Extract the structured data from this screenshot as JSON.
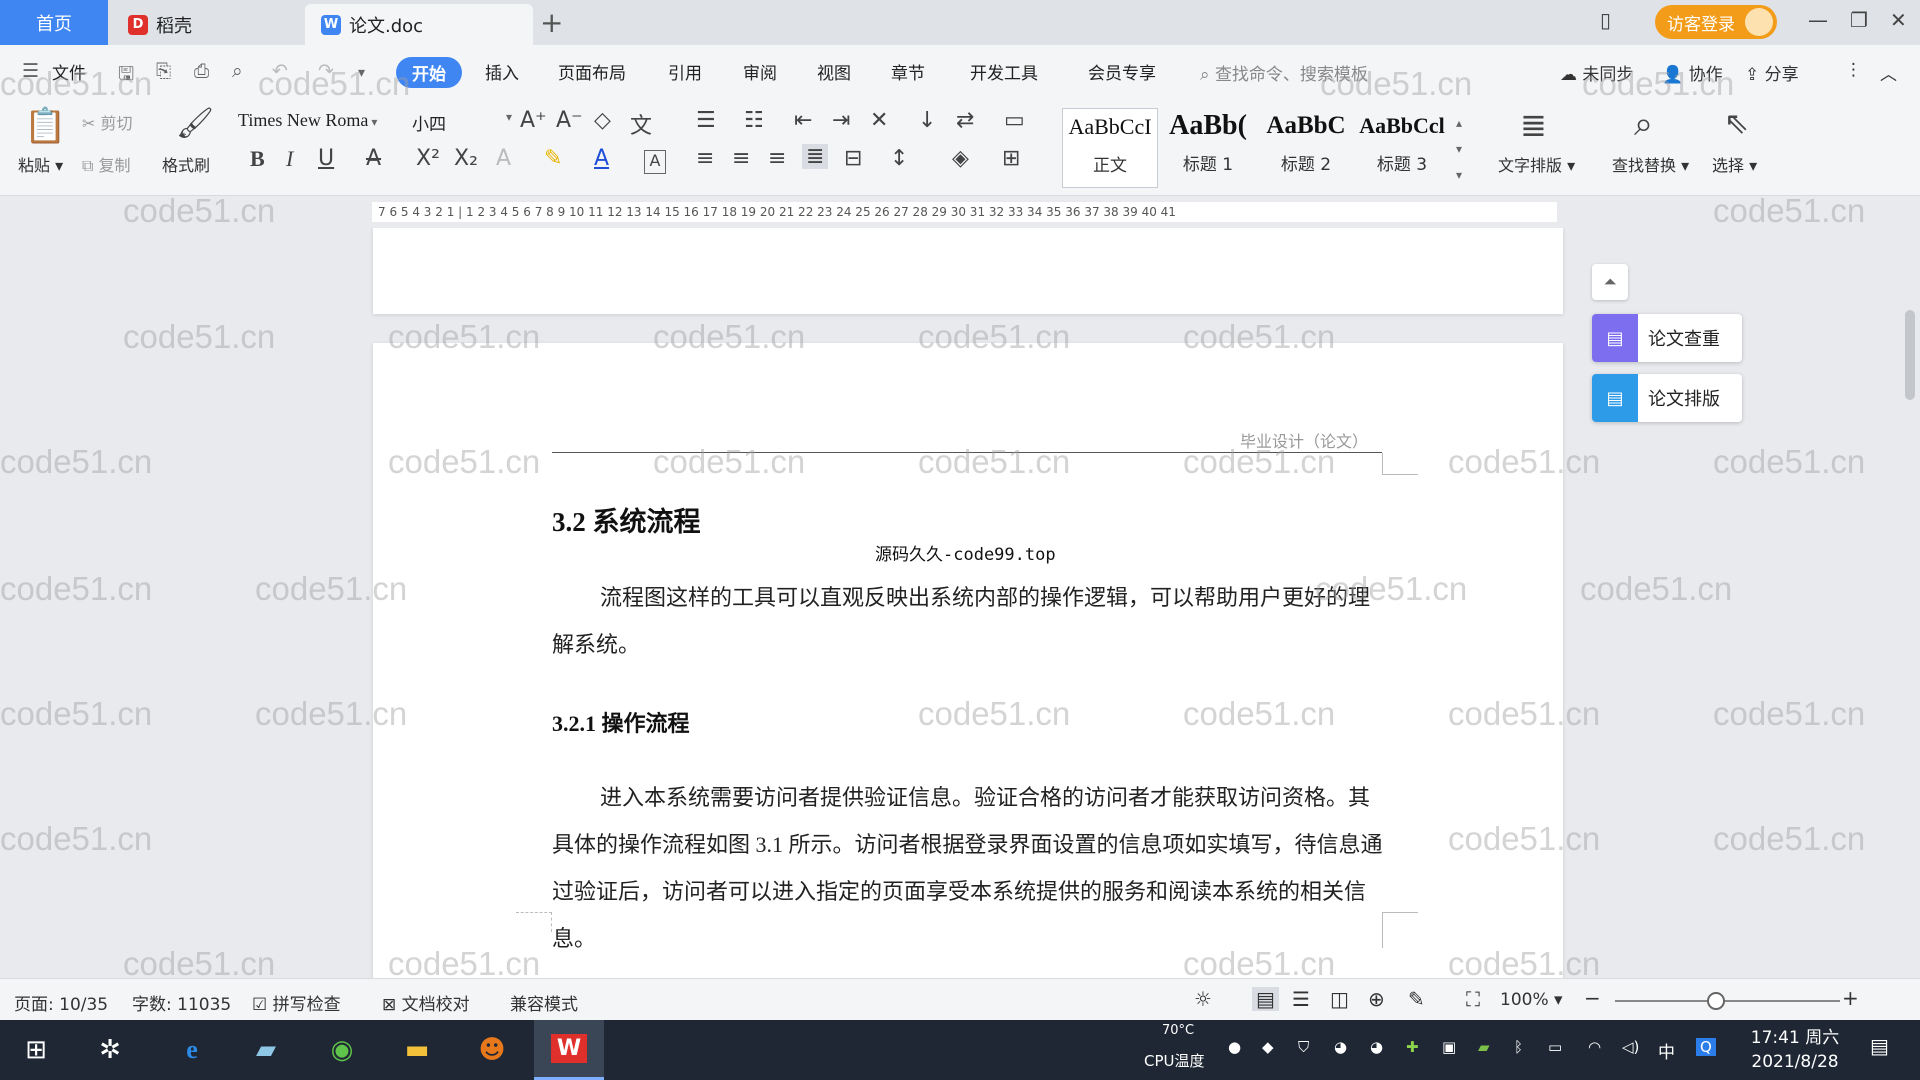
{
  "titlebar": {
    "home_tab": "首页",
    "tab1_label": "稻壳",
    "tab2_label": "论文.doc",
    "new_tab_symbol": "+",
    "login_label": "访客登录"
  },
  "menubar": {
    "file_label": "文件",
    "items": [
      "开始",
      "插入",
      "页面布局",
      "引用",
      "审阅",
      "视图",
      "章节",
      "开发工具",
      "会员专享"
    ],
    "search_placeholder": "查找命令、搜索模板",
    "unsync_label": "未同步",
    "collab_label": "协作",
    "share_label": "分享"
  },
  "ribbon": {
    "paste_label": "粘贴",
    "cut_label": "剪切",
    "copy_label": "复制",
    "format_painter_label": "格式刷",
    "font_name": "Times New Roma",
    "font_size": "小四",
    "styles": [
      {
        "sample": "AaBbCcI",
        "label": "正文"
      },
      {
        "sample": "AaBb(",
        "label": "标题 1"
      },
      {
        "sample": "AaBbC",
        "label": "标题 2"
      },
      {
        "sample": "AaBbCcl",
        "label": "标题 3"
      }
    ],
    "text_layout_label": "文字排版",
    "find_replace_label": "查找替换",
    "select_label": "选择"
  },
  "ruler": {
    "numbers": "7 6 5 4 3 2 1 | 1 2 3 4 5 6 7 8 9 10 11 12 13 14 15 16 17 18 19 20 21 22 23 24 25 26 27 28 29 30 31 32 33 34 35 36 37 38 39 40 41"
  },
  "document": {
    "header": "毕业设计（论文）",
    "section_heading": "3.2  系统流程",
    "watermark_line": "源码久久-code99.top",
    "para1": "流程图这样的工具可以直观反映出系统内部的操作逻辑，可以帮助用户更好的理解系统。",
    "subsection_heading": "3.2.1  操作流程",
    "para2": "进入本系统需要访问者提供验证信息。验证合格的访问者才能获取访问资格。其具体的操作流程如图 3.1 所示。访问者根据登录界面设置的信息项如实填写，待信息通过验证后，访问者可以进入指定的页面享受本系统提供的服务和阅读本系统的相关信息。"
  },
  "watermark_text": "code51.cn",
  "side_panel": {
    "check_label": "论文查重",
    "layout_label": "论文排版"
  },
  "statusbar": {
    "page": "页面: 10/35",
    "words": "字数: 11035",
    "spell_check": "拼写检查",
    "doc_proof": "文档校对",
    "compat_mode": "兼容模式",
    "zoom": "100%"
  },
  "taskbar": {
    "cpu_temp": "70°C",
    "cpu_label": "CPU温度",
    "ime": "中",
    "time": "17:41 周六",
    "date": "2021/8/28"
  },
  "colors": {
    "accent": "#3f86f3",
    "login": "#f39c1a",
    "taskbar": "#1e2733",
    "wps_red": "#e0302b"
  }
}
